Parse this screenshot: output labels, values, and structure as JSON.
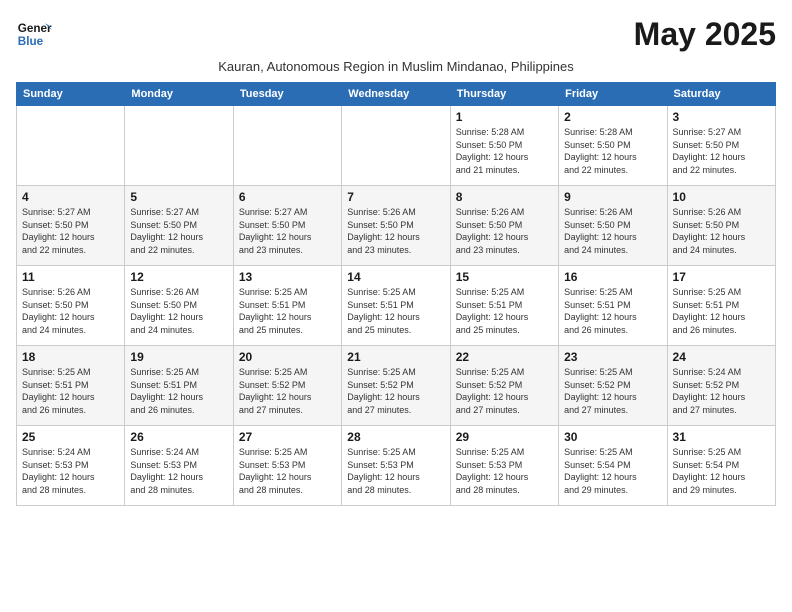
{
  "logo": {
    "line1": "General",
    "line2": "Blue"
  },
  "title": "May 2025",
  "subtitle": "Kauran, Autonomous Region in Muslim Mindanao, Philippines",
  "days_of_week": [
    "Sunday",
    "Monday",
    "Tuesday",
    "Wednesday",
    "Thursday",
    "Friday",
    "Saturday"
  ],
  "weeks": [
    [
      {
        "day": "",
        "info": ""
      },
      {
        "day": "",
        "info": ""
      },
      {
        "day": "",
        "info": ""
      },
      {
        "day": "",
        "info": ""
      },
      {
        "day": "1",
        "info": "Sunrise: 5:28 AM\nSunset: 5:50 PM\nDaylight: 12 hours\nand 21 minutes."
      },
      {
        "day": "2",
        "info": "Sunrise: 5:28 AM\nSunset: 5:50 PM\nDaylight: 12 hours\nand 22 minutes."
      },
      {
        "day": "3",
        "info": "Sunrise: 5:27 AM\nSunset: 5:50 PM\nDaylight: 12 hours\nand 22 minutes."
      }
    ],
    [
      {
        "day": "4",
        "info": "Sunrise: 5:27 AM\nSunset: 5:50 PM\nDaylight: 12 hours\nand 22 minutes."
      },
      {
        "day": "5",
        "info": "Sunrise: 5:27 AM\nSunset: 5:50 PM\nDaylight: 12 hours\nand 22 minutes."
      },
      {
        "day": "6",
        "info": "Sunrise: 5:27 AM\nSunset: 5:50 PM\nDaylight: 12 hours\nand 23 minutes."
      },
      {
        "day": "7",
        "info": "Sunrise: 5:26 AM\nSunset: 5:50 PM\nDaylight: 12 hours\nand 23 minutes."
      },
      {
        "day": "8",
        "info": "Sunrise: 5:26 AM\nSunset: 5:50 PM\nDaylight: 12 hours\nand 23 minutes."
      },
      {
        "day": "9",
        "info": "Sunrise: 5:26 AM\nSunset: 5:50 PM\nDaylight: 12 hours\nand 24 minutes."
      },
      {
        "day": "10",
        "info": "Sunrise: 5:26 AM\nSunset: 5:50 PM\nDaylight: 12 hours\nand 24 minutes."
      }
    ],
    [
      {
        "day": "11",
        "info": "Sunrise: 5:26 AM\nSunset: 5:50 PM\nDaylight: 12 hours\nand 24 minutes."
      },
      {
        "day": "12",
        "info": "Sunrise: 5:26 AM\nSunset: 5:50 PM\nDaylight: 12 hours\nand 24 minutes."
      },
      {
        "day": "13",
        "info": "Sunrise: 5:25 AM\nSunset: 5:51 PM\nDaylight: 12 hours\nand 25 minutes."
      },
      {
        "day": "14",
        "info": "Sunrise: 5:25 AM\nSunset: 5:51 PM\nDaylight: 12 hours\nand 25 minutes."
      },
      {
        "day": "15",
        "info": "Sunrise: 5:25 AM\nSunset: 5:51 PM\nDaylight: 12 hours\nand 25 minutes."
      },
      {
        "day": "16",
        "info": "Sunrise: 5:25 AM\nSunset: 5:51 PM\nDaylight: 12 hours\nand 26 minutes."
      },
      {
        "day": "17",
        "info": "Sunrise: 5:25 AM\nSunset: 5:51 PM\nDaylight: 12 hours\nand 26 minutes."
      }
    ],
    [
      {
        "day": "18",
        "info": "Sunrise: 5:25 AM\nSunset: 5:51 PM\nDaylight: 12 hours\nand 26 minutes."
      },
      {
        "day": "19",
        "info": "Sunrise: 5:25 AM\nSunset: 5:51 PM\nDaylight: 12 hours\nand 26 minutes."
      },
      {
        "day": "20",
        "info": "Sunrise: 5:25 AM\nSunset: 5:52 PM\nDaylight: 12 hours\nand 27 minutes."
      },
      {
        "day": "21",
        "info": "Sunrise: 5:25 AM\nSunset: 5:52 PM\nDaylight: 12 hours\nand 27 minutes."
      },
      {
        "day": "22",
        "info": "Sunrise: 5:25 AM\nSunset: 5:52 PM\nDaylight: 12 hours\nand 27 minutes."
      },
      {
        "day": "23",
        "info": "Sunrise: 5:25 AM\nSunset: 5:52 PM\nDaylight: 12 hours\nand 27 minutes."
      },
      {
        "day": "24",
        "info": "Sunrise: 5:24 AM\nSunset: 5:52 PM\nDaylight: 12 hours\nand 27 minutes."
      }
    ],
    [
      {
        "day": "25",
        "info": "Sunrise: 5:24 AM\nSunset: 5:53 PM\nDaylight: 12 hours\nand 28 minutes."
      },
      {
        "day": "26",
        "info": "Sunrise: 5:24 AM\nSunset: 5:53 PM\nDaylight: 12 hours\nand 28 minutes."
      },
      {
        "day": "27",
        "info": "Sunrise: 5:25 AM\nSunset: 5:53 PM\nDaylight: 12 hours\nand 28 minutes."
      },
      {
        "day": "28",
        "info": "Sunrise: 5:25 AM\nSunset: 5:53 PM\nDaylight: 12 hours\nand 28 minutes."
      },
      {
        "day": "29",
        "info": "Sunrise: 5:25 AM\nSunset: 5:53 PM\nDaylight: 12 hours\nand 28 minutes."
      },
      {
        "day": "30",
        "info": "Sunrise: 5:25 AM\nSunset: 5:54 PM\nDaylight: 12 hours\nand 29 minutes."
      },
      {
        "day": "31",
        "info": "Sunrise: 5:25 AM\nSunset: 5:54 PM\nDaylight: 12 hours\nand 29 minutes."
      }
    ]
  ]
}
